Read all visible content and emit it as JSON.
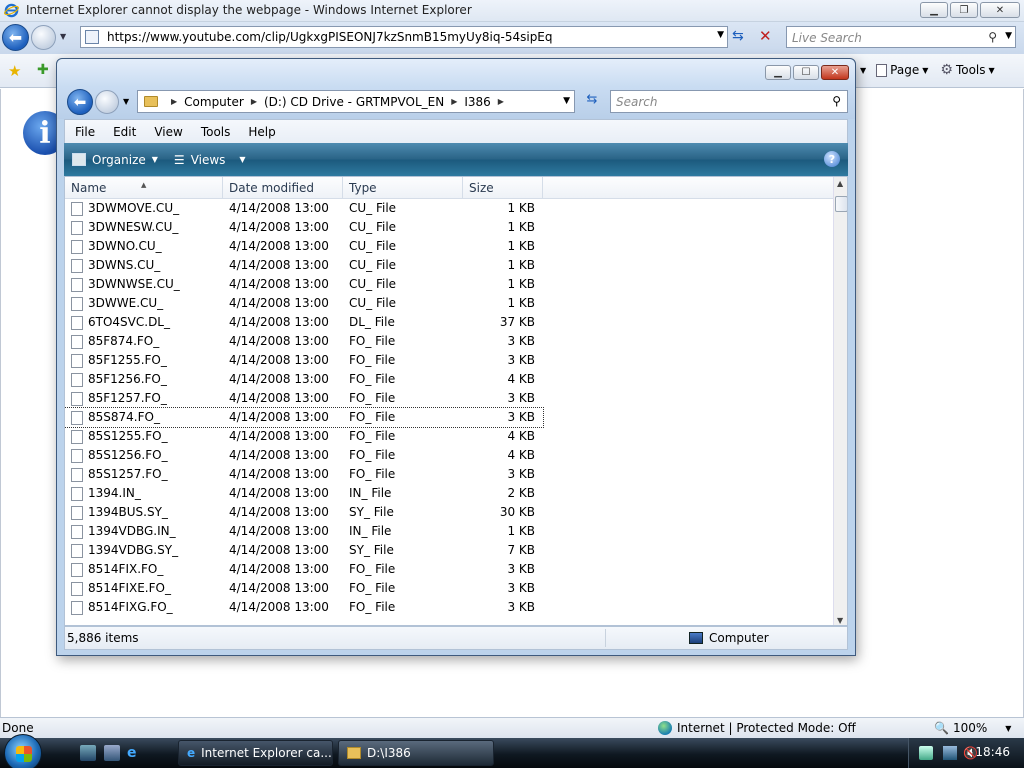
{
  "ie": {
    "title": "Internet Explorer cannot display the webpage - Windows Internet Explorer",
    "address": "https://www.youtube.com/clip/UgkxgPISEONJ7kzSnmB15myUy8iq-54sipEq",
    "search_placeholder": "Live Search",
    "toolbar": {
      "page": "Page",
      "tools": "Tools"
    },
    "status": {
      "left": "Done",
      "zone": "Internet | Protected Mode: Off",
      "zoom": "100%"
    }
  },
  "explorer": {
    "breadcrumb": [
      "Computer",
      "(D:) CD Drive - GRTMPVOL_EN",
      "I386"
    ],
    "search_placeholder": "Search",
    "menu": [
      "File",
      "Edit",
      "View",
      "Tools",
      "Help"
    ],
    "commands": {
      "organize": "Organize",
      "views": "Views"
    },
    "columns": [
      "Name",
      "Date modified",
      "Type",
      "Size"
    ],
    "files": [
      {
        "name": "3DWMOVE.CU_",
        "date": "4/14/2008 13:00",
        "type": "CU_ File",
        "size": "1 KB"
      },
      {
        "name": "3DWNESW.CU_",
        "date": "4/14/2008 13:00",
        "type": "CU_ File",
        "size": "1 KB"
      },
      {
        "name": "3DWNO.CU_",
        "date": "4/14/2008 13:00",
        "type": "CU_ File",
        "size": "1 KB"
      },
      {
        "name": "3DWNS.CU_",
        "date": "4/14/2008 13:00",
        "type": "CU_ File",
        "size": "1 KB"
      },
      {
        "name": "3DWNWSE.CU_",
        "date": "4/14/2008 13:00",
        "type": "CU_ File",
        "size": "1 KB"
      },
      {
        "name": "3DWWE.CU_",
        "date": "4/14/2008 13:00",
        "type": "CU_ File",
        "size": "1 KB"
      },
      {
        "name": "6TO4SVC.DL_",
        "date": "4/14/2008 13:00",
        "type": "DL_ File",
        "size": "37 KB"
      },
      {
        "name": "85F874.FO_",
        "date": "4/14/2008 13:00",
        "type": "FO_ File",
        "size": "3 KB"
      },
      {
        "name": "85F1255.FO_",
        "date": "4/14/2008 13:00",
        "type": "FO_ File",
        "size": "3 KB"
      },
      {
        "name": "85F1256.FO_",
        "date": "4/14/2008 13:00",
        "type": "FO_ File",
        "size": "4 KB"
      },
      {
        "name": "85F1257.FO_",
        "date": "4/14/2008 13:00",
        "type": "FO_ File",
        "size": "3 KB"
      },
      {
        "name": "85S874.FO_",
        "date": "4/14/2008 13:00",
        "type": "FO_ File",
        "size": "3 KB",
        "focused": true
      },
      {
        "name": "85S1255.FO_",
        "date": "4/14/2008 13:00",
        "type": "FO_ File",
        "size": "4 KB"
      },
      {
        "name": "85S1256.FO_",
        "date": "4/14/2008 13:00",
        "type": "FO_ File",
        "size": "4 KB"
      },
      {
        "name": "85S1257.FO_",
        "date": "4/14/2008 13:00",
        "type": "FO_ File",
        "size": "3 KB"
      },
      {
        "name": "1394.IN_",
        "date": "4/14/2008 13:00",
        "type": "IN_ File",
        "size": "2 KB"
      },
      {
        "name": "1394BUS.SY_",
        "date": "4/14/2008 13:00",
        "type": "SY_ File",
        "size": "30 KB"
      },
      {
        "name": "1394VDBG.IN_",
        "date": "4/14/2008 13:00",
        "type": "IN_ File",
        "size": "1 KB"
      },
      {
        "name": "1394VDBG.SY_",
        "date": "4/14/2008 13:00",
        "type": "SY_ File",
        "size": "7 KB"
      },
      {
        "name": "8514FIX.FO_",
        "date": "4/14/2008 13:00",
        "type": "FO_ File",
        "size": "3 KB"
      },
      {
        "name": "8514FIXE.FO_",
        "date": "4/14/2008 13:00",
        "type": "FO_ File",
        "size": "3 KB"
      },
      {
        "name": "8514FIXG.FO_",
        "date": "4/14/2008 13:00",
        "type": "FO_ File",
        "size": "3 KB"
      }
    ],
    "status": {
      "count": "5,886 items",
      "location": "Computer"
    }
  },
  "taskbar": {
    "tasks": [
      "Internet Explorer ca...",
      "D:\\I386"
    ],
    "clock": "18:46"
  }
}
